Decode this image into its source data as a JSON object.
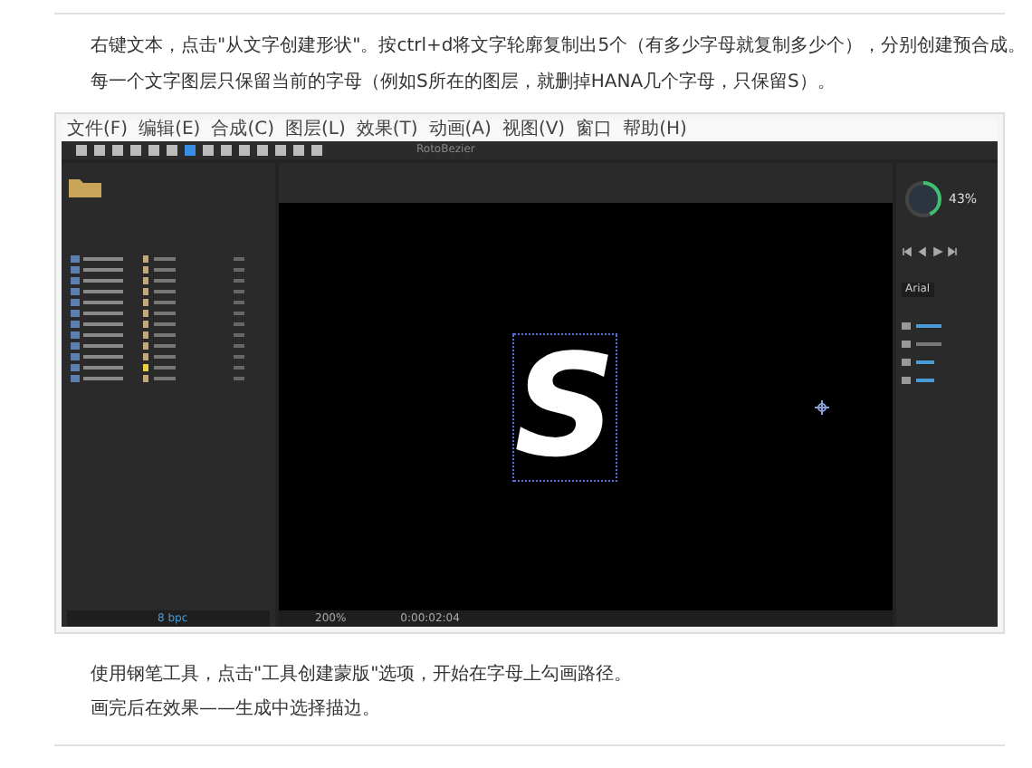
{
  "paragraphs_top": [
    "右键文本，点击\"从文字创建形状\"。按ctrl+d将文字轮廓复制出5个（有多少字母就复制多少个），分别创建预合成。",
    "每一个文字图层只保留当前的字母（例如S所在的图层，就删掉HANA几个字母，只保留S）。"
  ],
  "app": {
    "menu": [
      "文件(F)",
      "编辑(E)",
      "合成(C)",
      "图层(L)",
      "效果(T)",
      "动画(A)",
      "视图(V)",
      "窗口",
      "帮助(H)"
    ],
    "toolbar": {
      "option": "RotoBezier"
    },
    "project": {
      "bit_depth": "8 bpc"
    },
    "viewer": {
      "letter": "S",
      "zoom": "200%",
      "timecode": "0:00:02:04"
    },
    "info": {
      "meter": {
        "reading": "43%",
        "level": 0.43
      }
    },
    "character": {
      "font": "Arial"
    }
  },
  "paragraphs_bottom": [
    "使用钢笔工具，点击\"工具创建蒙版\"选项，开始在字母上勾画路径。",
    "画完后在效果——生成中选择描边。"
  ]
}
